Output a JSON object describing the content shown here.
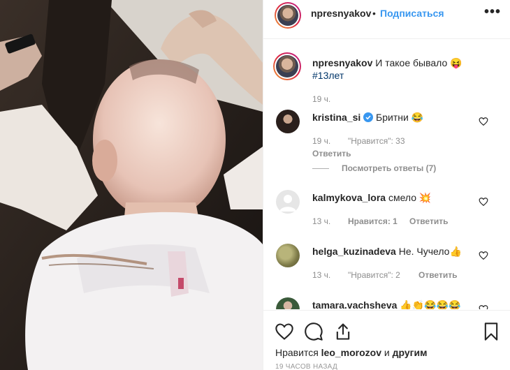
{
  "header": {
    "username": "npresnyakov",
    "separator": "•",
    "follow_label": "Подписаться",
    "more_label": "•••"
  },
  "caption": {
    "username": "npresnyakov",
    "text": "И такое бывало",
    "emoji": "😝",
    "hashtag": "#13лет",
    "time": "19 ч."
  },
  "comments": [
    {
      "username": "kristina_si",
      "text": "Бритни",
      "emoji": "😂",
      "time": "19 ч.",
      "likes": "\"Нравится\": 33",
      "reply": "Ответить",
      "verified": true,
      "view_replies": "Посмотреть ответы (7)"
    },
    {
      "username": "kalmykova_lora",
      "text": "смело",
      "emoji": "💥",
      "time": "13 ч.",
      "likes_prefix": "Нравится:",
      "likes_count": "1",
      "reply": "Ответить"
    },
    {
      "username": "helga_kuzinadeva",
      "text": "Не. Чучело",
      "emoji": "👍",
      "time": "13 ч.",
      "likes": "\"Нравится\": 2",
      "reply": "Ответить"
    },
    {
      "username": "tamara.vachsheva",
      "text": "",
      "emoji": "👍👏😂😂😂",
      "time": "",
      "likes": "",
      "reply": ""
    }
  ],
  "actions": {
    "likes_prefix": "Нравится",
    "likes_user": "leo_morozov",
    "likes_and": "и",
    "likes_others": "другим",
    "time_ago": "19 ЧАСОВ НАЗАД"
  },
  "icons": [
    "heart-icon",
    "comment-icon",
    "share-icon",
    "bookmark-icon",
    "more-icon",
    "verified-icon"
  ],
  "colors": {
    "link": "#3897f0",
    "muted": "#8e8e8e",
    "text": "#262626"
  }
}
